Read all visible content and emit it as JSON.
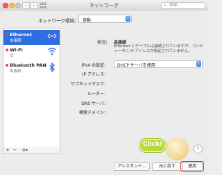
{
  "window": {
    "title": "ネットワーク"
  },
  "search": {
    "placeholder": "検索"
  },
  "location": {
    "label": "ネットワーク環境：",
    "value": "自動"
  },
  "services": [
    {
      "name": "Ethernet",
      "status": "未接続",
      "icon": "ethernet-icon",
      "selected": true
    },
    {
      "name": "Wi-Fi",
      "status": "切",
      "icon": "wifi-icon",
      "selected": false
    },
    {
      "name": "Bluetooth PAN",
      "status": "未接続",
      "icon": "bluetooth-icon",
      "selected": false
    }
  ],
  "sidebar_toolbar": {
    "add": "+",
    "remove": "−",
    "gear": "⚙▾"
  },
  "detail": {
    "status_label": "状況：",
    "status_value": "未接続",
    "status_desc": "Ethernet にケーブルは接続されていますが、コンピュータに IP アドレスが設定されていません。",
    "ipv4_label": "IPv4 の設定：",
    "ipv4_value": "DHCP サーバを使用",
    "ip_label": "IP アドレス：",
    "subnet_label": "サブネットマスク：",
    "router_label": "ルーター：",
    "dns_label": "DNS サーバ：",
    "search_domain_label": "検索ドメイン："
  },
  "annotation": {
    "click_text": "Click!"
  },
  "buttons": {
    "assistant": "アシスタント...",
    "revert": "元に戻す",
    "apply": "適用",
    "help": "?"
  },
  "colors": {
    "selection": "#2f6ee0",
    "status_dot": "#e0493e",
    "click_bubble": "#b8d93e",
    "highlight": "#d9342b"
  }
}
